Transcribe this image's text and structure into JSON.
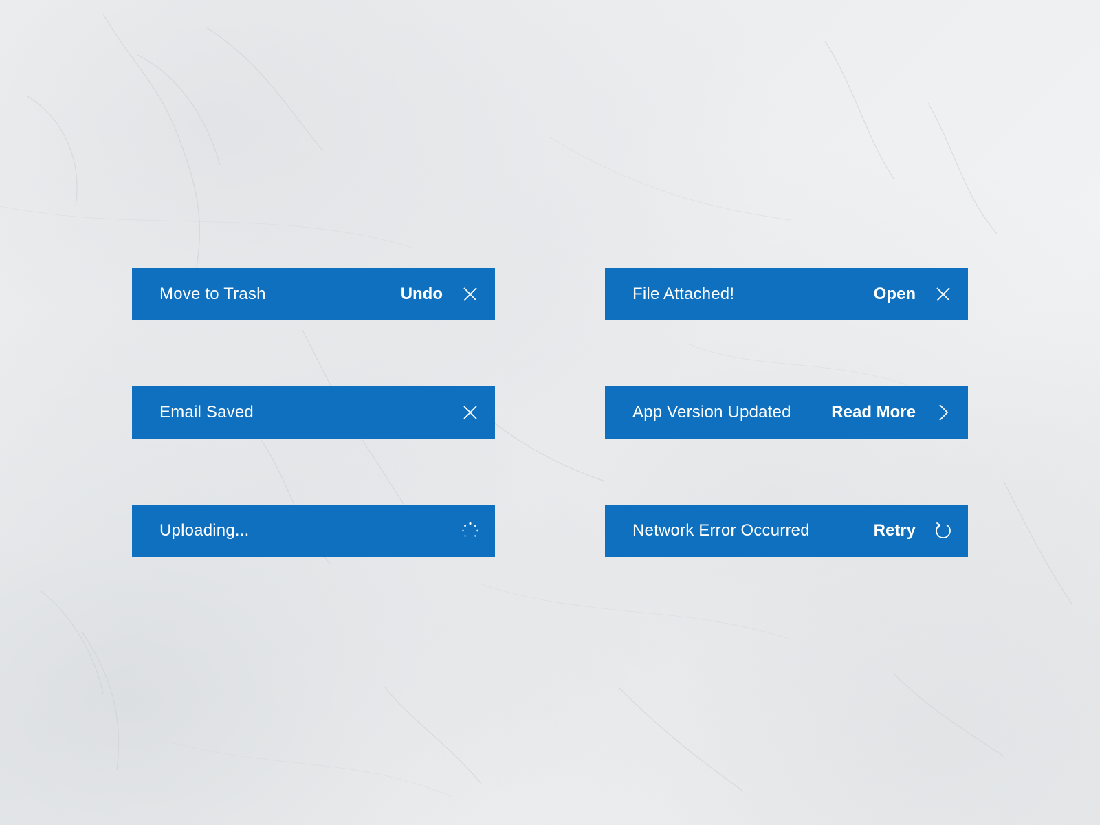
{
  "colors": {
    "toast_background": "#0e70be",
    "toast_text": "#ffffff",
    "page_background": "#eef0f1"
  },
  "toasts": [
    {
      "message": "Move to Trash",
      "action": "Undo",
      "icon": "close-icon"
    },
    {
      "message": "File Attached!",
      "action": "Open",
      "icon": "close-icon"
    },
    {
      "message": "Email Saved",
      "action": "",
      "icon": "close-icon"
    },
    {
      "message": "App Version Updated",
      "action": "Read More",
      "icon": "chevron-right-icon"
    },
    {
      "message": "Uploading...",
      "action": "",
      "icon": "spinner-icon"
    },
    {
      "message": "Network Error Occurred",
      "action": "Retry",
      "icon": "refresh-icon"
    }
  ]
}
